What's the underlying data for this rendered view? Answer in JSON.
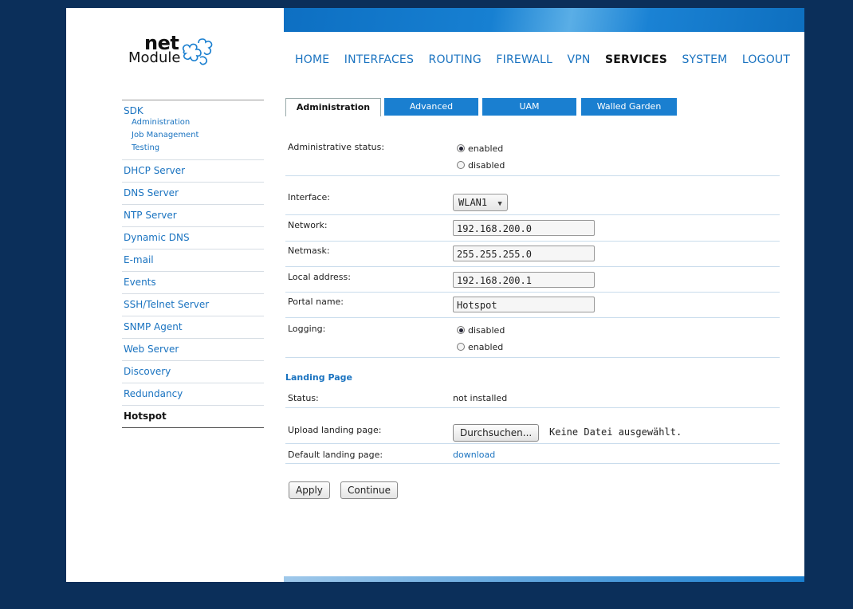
{
  "logo": {
    "net": "net",
    "module": "Module"
  },
  "topnav": [
    "HOME",
    "INTERFACES",
    "ROUTING",
    "FIREWALL",
    "VPN",
    "SERVICES",
    "SYSTEM",
    "LOGOUT"
  ],
  "topnav_active": "SERVICES",
  "sidebar": {
    "sdk": {
      "label": "SDK",
      "subitems": [
        "Administration",
        "Job Management",
        "Testing"
      ]
    },
    "items": [
      "DHCP Server",
      "DNS Server",
      "NTP Server",
      "Dynamic DNS",
      "E-mail",
      "Events",
      "SSH/Telnet Server",
      "SNMP Agent",
      "Web Server",
      "Discovery",
      "Redundancy",
      "Hotspot"
    ],
    "active": "Hotspot"
  },
  "tabs": [
    "Administration",
    "Advanced",
    "UAM",
    "Walled Garden"
  ],
  "tabs_active": "Administration",
  "form": {
    "admin_status": {
      "label": "Administrative status:",
      "options": [
        "enabled",
        "disabled"
      ],
      "selected": "enabled"
    },
    "interface": {
      "label": "Interface:",
      "value": "WLAN1"
    },
    "network": {
      "label": "Network:",
      "value": "192.168.200.0"
    },
    "netmask": {
      "label": "Netmask:",
      "value": "255.255.255.0"
    },
    "local_address": {
      "label": "Local address:",
      "value": "192.168.200.1"
    },
    "portal_name": {
      "label": "Portal name:",
      "value": "Hotspot"
    },
    "logging": {
      "label": "Logging:",
      "options": [
        "disabled",
        "enabled"
      ],
      "selected": "disabled"
    }
  },
  "landing": {
    "title": "Landing Page",
    "status_label": "Status:",
    "status_value": "not installed",
    "upload_label": "Upload landing page:",
    "browse_button": "Durchsuchen...",
    "no_file": "Keine Datei ausgewählt.",
    "default_label": "Default landing page:",
    "default_link": "download"
  },
  "buttons": {
    "apply": "Apply",
    "continue": "Continue"
  },
  "colors": {
    "accent": "#1a7fd0",
    "background": "#0b2f5a"
  }
}
